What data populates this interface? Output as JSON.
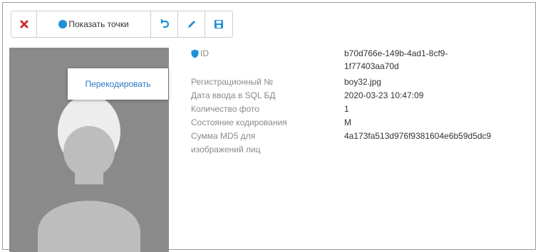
{
  "toolbar": {
    "close_icon": "close-icon",
    "show_points_label": "Показать точки",
    "undo_icon": "undo-icon",
    "edit_icon": "pencil-icon",
    "save_icon": "save-icon",
    "accent": "#1e90d6",
    "close_color": "#c9302c"
  },
  "popup": {
    "recode_label": "Перекодировать"
  },
  "details": {
    "id_label": "ID",
    "id_value_line1": "b70d766e-149b-4ad1-8cf9-",
    "id_value_line2": "1f77403aa70d",
    "reg_label": "Регистрационный №",
    "reg_value": "boy32.jpg",
    "date_label": "Дата ввода в SQL БД",
    "date_value": "2020-03-23 10:47:09",
    "count_label": "Количество фото",
    "count_value": "1",
    "state_label": "Состояние кодирования",
    "state_value": "M",
    "md5_label_line1": "Сумма MD5 для",
    "md5_label_line2": "изображений лиц",
    "md5_value": "4a173fa513d976f9381604e6b59d5dc9"
  }
}
